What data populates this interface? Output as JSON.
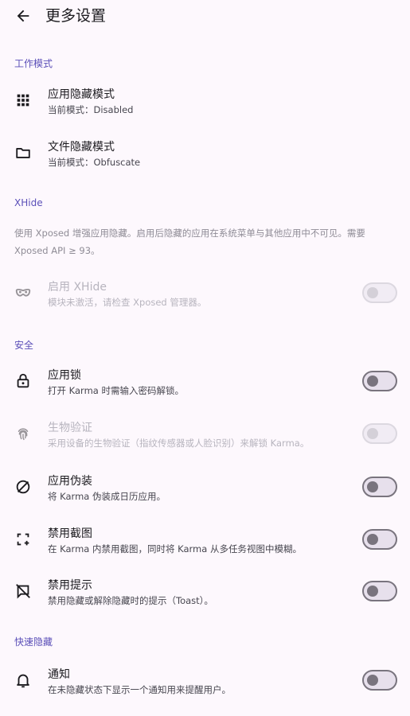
{
  "header": {
    "title": "更多设置"
  },
  "sections": {
    "work_mode": "工作模式",
    "xhide": "XHide",
    "security": "安全",
    "quick_hide": "快速隐藏"
  },
  "work_mode": {
    "app_hide": {
      "title": "应用隐藏模式",
      "subtitle": "当前模式：Disabled"
    },
    "file_hide": {
      "title": "文件隐藏模式",
      "subtitle": "当前模式：Obfuscate"
    }
  },
  "xhide": {
    "description": "使用 Xposed 增强应用隐藏。启用后隐藏的应用在系统菜单与其他应用中不可见。需要 Xposed API ≥ 93。",
    "enable": {
      "title": "启用 XHide",
      "subtitle": "模块未激活，请检查 Xposed 管理器。",
      "checked": false,
      "enabled": false
    }
  },
  "security": {
    "app_lock": {
      "title": "应用锁",
      "subtitle": "打开 Karma 时需输入密码解锁。",
      "checked": false
    },
    "biometric": {
      "title": "生物验证",
      "subtitle": "采用设备的生物验证（指纹传感器或人脸识别）来解锁 Karma。",
      "checked": false,
      "enabled": false
    },
    "disguise": {
      "title": "应用伪装",
      "subtitle": "将 Karma 伪装成日历应用。",
      "checked": false
    },
    "no_screenshot": {
      "title": "禁用截图",
      "subtitle": "在 Karma 内禁用截图，同时将 Karma 从多任务视图中模糊。",
      "checked": false
    },
    "no_toast": {
      "title": "禁用提示",
      "subtitle": "禁用隐藏或解除隐藏时的提示（Toast）。",
      "checked": false
    }
  },
  "quick_hide": {
    "notification": {
      "title": "通知",
      "subtitle": "在未隐藏状态下显示一个通知用来提醒用户。",
      "checked": false
    }
  },
  "colors": {
    "accent": "#5b4fb8",
    "background": "#fdf8fd",
    "text": "#1c1b1f",
    "secondary_text": "#47464f",
    "disabled_text": "#b7b4be"
  }
}
